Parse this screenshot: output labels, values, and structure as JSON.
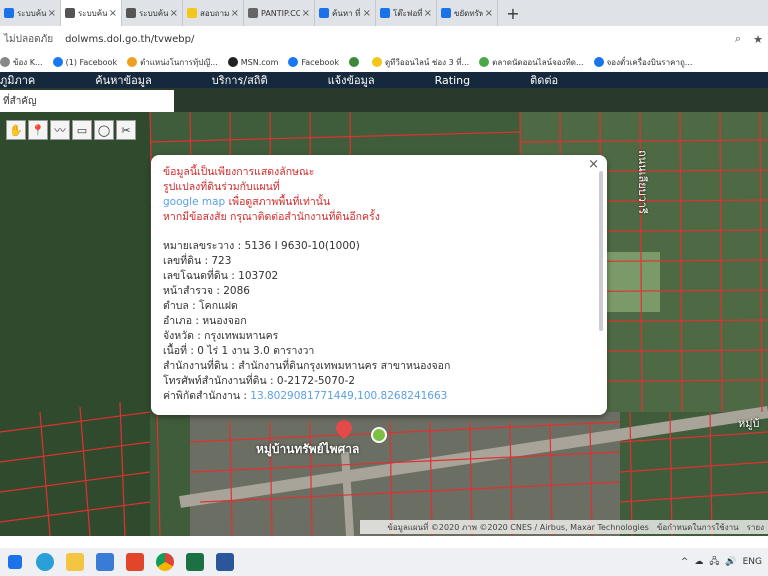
{
  "tabs": [
    {
      "label": "ระบบค้นหาฯลฯ",
      "color": "#1a73e8",
      "active": false
    },
    {
      "label": "ระบบค้นหารูปฯ",
      "color": "#555555",
      "active": true
    },
    {
      "label": "ระบบค้นหารูปฯ",
      "color": "#555555",
      "active": false
    },
    {
      "label": "สอบถามเจ้าหน้า",
      "color": "#f5c518",
      "active": false
    },
    {
      "label": "PANTIP.COM",
      "color": "#666666",
      "active": false
    },
    {
      "label": "ค้นหา ที่ดิน ",
      "color": "#1a73e8",
      "active": false
    },
    {
      "label": "โต๊ะฟอที่ดินรูปฯ",
      "color": "#1a73e8",
      "active": false
    },
    {
      "label": "ขยัดทรัพย์ 10",
      "color": "#1a73e8",
      "active": false
    }
  ],
  "new_tab_label": "+",
  "address_bar": {
    "security": "ไม่ปลอดภัย",
    "url": "dolwms.dol.go.th/tvwebp/"
  },
  "bookmarks": [
    {
      "label": "ข้อง K...",
      "color": "#888888"
    },
    {
      "label": "(1) Facebook",
      "color": "#1877f2"
    },
    {
      "label": "ตำแหน่งโนการทุ้ปญึ...",
      "color": "#f0a020"
    },
    {
      "label": "MSN.com",
      "color": "#222222"
    },
    {
      "label": "Facebook",
      "color": "#1877f2"
    },
    {
      "label": "",
      "color": "#3a8a3a"
    },
    {
      "label": "ดูทีวีออนไลน์ ช่อง 3 ที่...",
      "color": "#f5c518"
    },
    {
      "label": "ตลาดนัดออนไลน์จองทีด...",
      "color": "#4aa84a"
    },
    {
      "label": "จองตั๋วเครื่องบินราคาถู...",
      "color": "#1a73e8"
    }
  ],
  "site_nav": [
    "ภูมิภาค",
    "ค้นหาข้อมูล",
    "บริการ/สถิติ",
    "แจ้งข้อมูล",
    "Rating",
    "ติดต่อ"
  ],
  "search_text": "ที่สำคัญ",
  "map_tools": [
    "✋",
    "📍",
    "〰",
    "▭",
    "◯",
    "✂"
  ],
  "popup": {
    "close": "×",
    "disclaimer": [
      "ข้อมูลนี้เป็นเพียงการแสดงลักษณะ",
      "รูปแปลงที่ดินร่วมกับแผนที่"
    ],
    "disclaimer_link_prefix": "google map",
    "disclaimer_rest": [
      " เพื่อดูสภาพพื้นที่เท่านั้น",
      "หากมีข้อสงสัย กรุณาติดต่อสำนักงานที่ดินอีกครั้ง"
    ],
    "fields": [
      {
        "label": "หมายเลขระวาง",
        "value": "5136 I 9630-10(1000)"
      },
      {
        "label": "เลขที่ดิน",
        "value": "723"
      },
      {
        "label": "เลขโฉนดที่ดิน",
        "value": "103702"
      },
      {
        "label": "หน้าสำรวจ",
        "value": "2086"
      },
      {
        "label": "ตำบล",
        "value": "โคกแฝด"
      },
      {
        "label": "อำเภอ",
        "value": "หนองจอก"
      },
      {
        "label": "จังหวัด",
        "value": "กรุงเทพมหานคร"
      },
      {
        "label": "เนื้อที่",
        "value": "0 ไร่ 1 งาน 3.0 ตารางวา"
      },
      {
        "label": "สำนักงานที่ดิน",
        "value": "สำนักงานที่ดินกรุงเทพมหานคร สาขาหนองจอก"
      },
      {
        "label": "โทรศัพท์สำนักงานที่ดิน",
        "value": "0-2172-5070-2"
      }
    ],
    "coord_label": "ค่าพิกัดสำนักงาน",
    "coord_value": "13.8029081771449,100.8268241663"
  },
  "map_labels": {
    "village": "หมู่บ้านทรัพย์ไพศาล",
    "village2": "หมู่บ้",
    "road": "ถนนเลียบวารี"
  },
  "attribution": {
    "main": "ข้อมูลแผนที่ ©2020 ภาพ ©2020 CNES / Airbus, Maxar Technologies",
    "terms": "ข้อกำหนดในการใช้งาน",
    "report": "รายง"
  },
  "colors": {
    "parcel_line": "#e23030",
    "nav_bg": "#16283c",
    "pin_green": "#7bc043",
    "pin_red": "#e34a4a"
  },
  "tray_icons": [
    "^",
    "☁",
    "🖧",
    "🔊",
    "ENG"
  ]
}
